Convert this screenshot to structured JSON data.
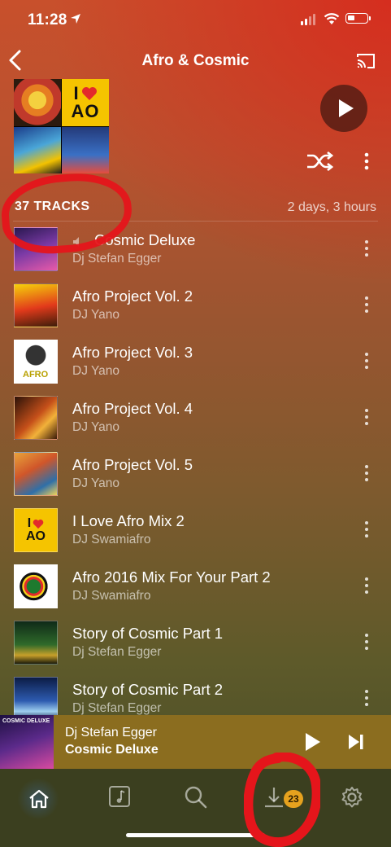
{
  "status_bar": {
    "time": "11:28"
  },
  "header": {
    "title": "Afro & Cosmic"
  },
  "playlist": {
    "tracks_count": "37 TRACKS",
    "duration": "2 days, 3 hours",
    "cover_text": {
      "love_top": "I",
      "love_bottom": "AO"
    }
  },
  "tracks": [
    {
      "title": "Cosmic Deluxe",
      "artist": "Dj Stefan Egger",
      "playing": true
    },
    {
      "title": "Afro Project Vol. 2",
      "artist": "DJ Yano"
    },
    {
      "title": "Afro Project Vol. 3",
      "artist": "DJ Yano",
      "thumb_text": "AFRO"
    },
    {
      "title": "Afro Project Vol. 4",
      "artist": "DJ Yano"
    },
    {
      "title": "Afro Project Vol. 5",
      "artist": "DJ Yano"
    },
    {
      "title": "I Love Afro Mix 2",
      "artist": "DJ Swamiafro",
      "thumb_text": "AO"
    },
    {
      "title": "Afro 2016 Mix For Your Part 2",
      "artist": "DJ Swamiafro"
    },
    {
      "title": "Story of Cosmic Part 1",
      "artist": "Dj Stefan Egger"
    },
    {
      "title": "Story of Cosmic Part 2",
      "artist": "Dj Stefan Egger"
    }
  ],
  "mini_player": {
    "artist": "Dj Stefan Egger",
    "title": "Cosmic Deluxe",
    "art_text": "COSMIC DELUXE"
  },
  "tab_bar": {
    "items": [
      "home",
      "library",
      "search",
      "downloads",
      "settings"
    ],
    "active": "home",
    "downloads_badge": "23"
  },
  "colors": {
    "accent_badge": "#e6a21e",
    "annotation": "#e5151b"
  }
}
